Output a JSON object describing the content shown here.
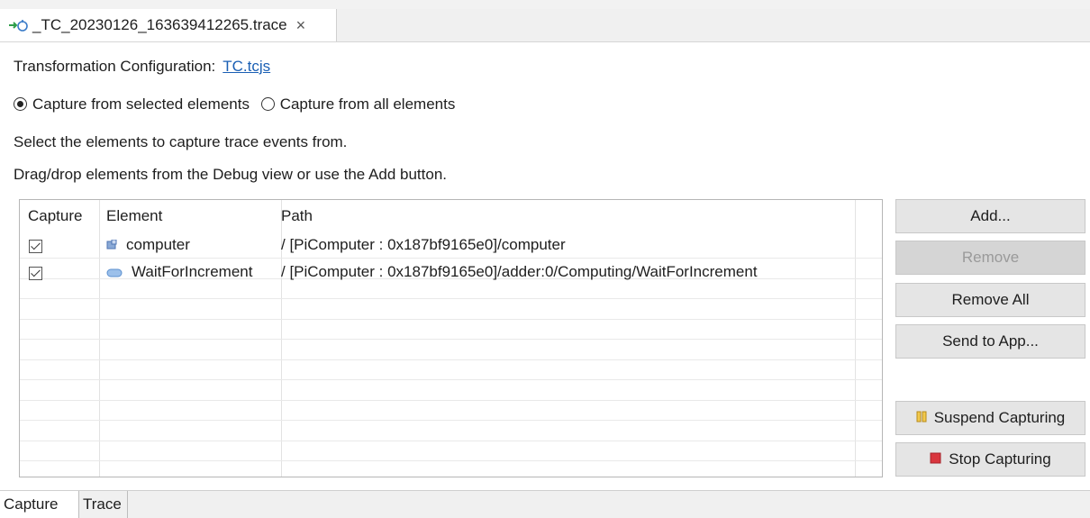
{
  "editor_tab": {
    "title": "_TC_20230126_163639412265.trace",
    "close_glyph": "×",
    "icon": "trace-file-icon"
  },
  "transformation": {
    "label": "Transformation Configuration:",
    "link": "TC.tcjs"
  },
  "capture_mode": {
    "option_selected": "Capture from selected elements",
    "option_other": "Capture from all elements",
    "selected_index": 0
  },
  "instructions": {
    "line1": "Select the elements to capture trace events from.",
    "line2": "Drag/drop elements from the Debug view or use the Add button."
  },
  "table": {
    "columns": [
      "Capture",
      "Element",
      "Path"
    ],
    "rows": [
      {
        "checked": true,
        "icon": "part-icon",
        "element": "computer",
        "path": "/ [PiComputer : 0x187bf9165e0]/computer"
      },
      {
        "checked": true,
        "icon": "state-icon",
        "element": "WaitForIncrement",
        "path": "/ [PiComputer : 0x187bf9165e0]/adder:0/Computing/WaitForIncrement"
      }
    ]
  },
  "buttons": {
    "add": "Add...",
    "remove": "Remove",
    "remove_all": "Remove All",
    "send_to_app": "Send to App...",
    "suspend": "Suspend Capturing",
    "stop": "Stop Capturing"
  },
  "bottom_tabs": [
    "Capture",
    "Trace"
  ],
  "colors": {
    "link": "#1a5fb4",
    "suspend_icon": "#e0b020",
    "stop_icon": "#d9363e",
    "state_icon": "#6a9fd8"
  }
}
